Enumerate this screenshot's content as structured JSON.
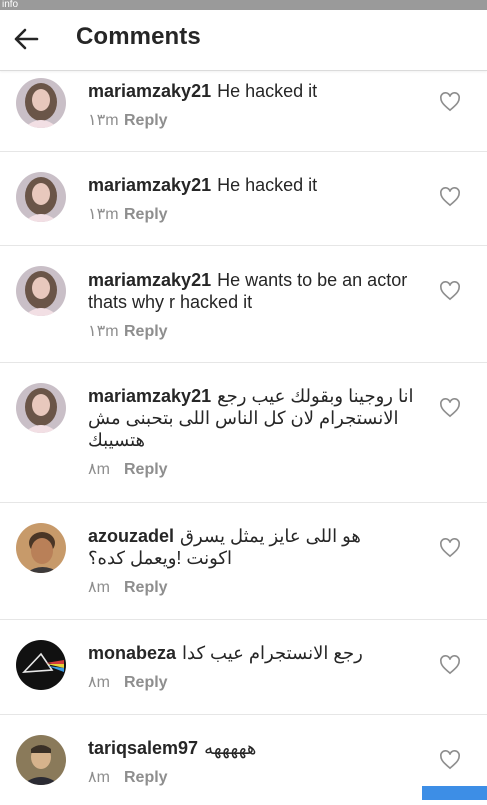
{
  "status_bar": {
    "label": "info"
  },
  "header": {
    "title": "Comments"
  },
  "comments": [
    {
      "user": "mariamzaky21",
      "text": "He hacked it",
      "time": "١٣m",
      "reply": "Reply"
    },
    {
      "user": "mariamzaky21",
      "text": "He hacked it",
      "time": "١٣m",
      "reply": "Reply"
    },
    {
      "user": "mariamzaky21",
      "text": "He wants to be an actor thats why r hacked it",
      "time": "١٣m",
      "reply": "Reply"
    },
    {
      "user": "mariamzaky21",
      "text": "انا روجينا وبقولك عيب رجع الانستجرام لان كل الناس اللى بتحبنى مش هتسيبك",
      "time": "٨m",
      "reply": "Reply"
    },
    {
      "user": "azouzadel",
      "text": "هو اللى عايز يمثل يسرق اكونت !ويعمل كده؟",
      "time": "٨m",
      "reply": "Reply"
    },
    {
      "user": "monabeza",
      "text": "رجع الانستجرام عيب كدا",
      "time": "٨m",
      "reply": "Reply"
    },
    {
      "user": "tariqsalem97",
      "text": "هههههه",
      "time": "٨m",
      "reply": "Reply"
    }
  ],
  "colors": {
    "accent": "#3d8ee6",
    "text": "#262626",
    "muted": "#8e8e8e",
    "divider": "#e6e6e6"
  },
  "icons": {
    "back": "arrow-left-icon",
    "like": "heart-outline-icon"
  }
}
